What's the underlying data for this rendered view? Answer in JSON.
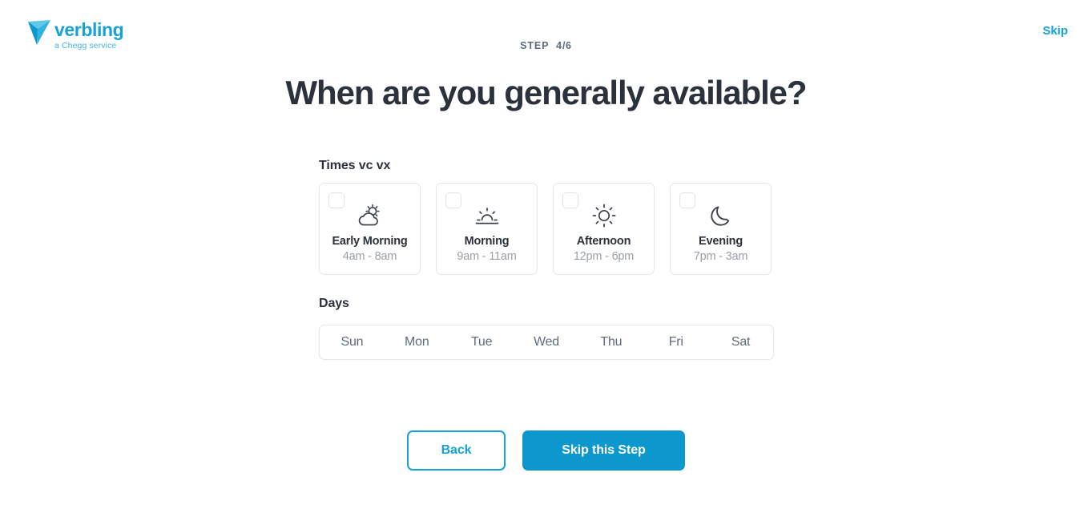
{
  "brand": {
    "name": "verbling",
    "tagline": "a Chegg service",
    "logo_icon": "paper-plane-icon",
    "color": "#17a2d6"
  },
  "header": {
    "step_label": "STEP",
    "step_current": "4",
    "step_separator": "/",
    "step_total": "6",
    "skip_label": "Skip"
  },
  "main": {
    "title": "When are you generally available?",
    "times": {
      "label": "Times vc vx",
      "options": [
        {
          "icon": "sun-behind-cloud-icon",
          "name": "Early Morning",
          "range": "4am - 8am",
          "checked": false
        },
        {
          "icon": "sunrise-icon",
          "name": "Morning",
          "range": "9am - 11am",
          "checked": false
        },
        {
          "icon": "sun-icon",
          "name": "Afternoon",
          "range": "12pm - 6pm",
          "checked": false
        },
        {
          "icon": "moon-icon",
          "name": "Evening",
          "range": "7pm - 3am",
          "checked": false
        }
      ]
    },
    "days": {
      "label": "Days",
      "options": [
        {
          "label": "Sun",
          "selected": false
        },
        {
          "label": "Mon",
          "selected": false
        },
        {
          "label": "Tue",
          "selected": false
        },
        {
          "label": "Wed",
          "selected": false
        },
        {
          "label": "Thu",
          "selected": false
        },
        {
          "label": "Fri",
          "selected": false
        },
        {
          "label": "Sat",
          "selected": false
        }
      ]
    }
  },
  "footer": {
    "back_label": "Back",
    "skip_step_label": "Skip this Step",
    "primary_color": "#0c98cc"
  }
}
